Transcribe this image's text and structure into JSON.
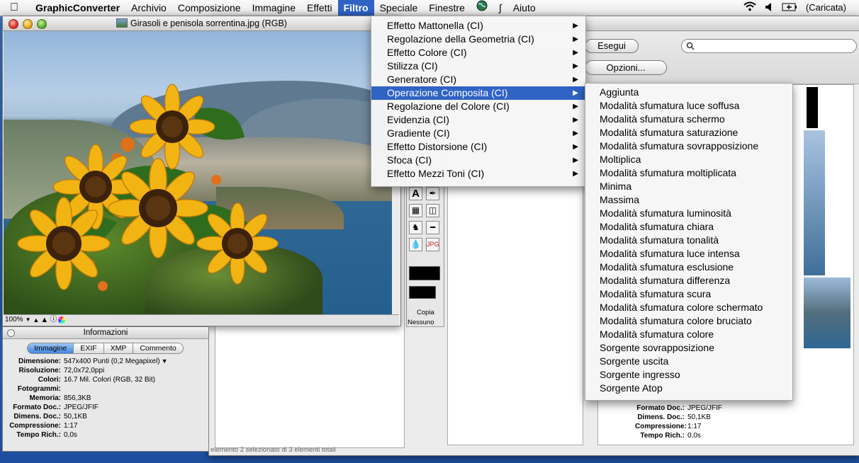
{
  "menubar": {
    "app_name": "GraphicConverter",
    "items": [
      "Archivio",
      "Composizione",
      "Immagine",
      "Effetti",
      "Filtro",
      "Speciale",
      "Finestre"
    ],
    "help": "Aiuto",
    "battery": "(Caricata)"
  },
  "image_window": {
    "title": "Girasoli e penisola sorrentina.jpg (RGB)",
    "zoom": "100%"
  },
  "info_panel": {
    "title": "Informazioni",
    "tabs": [
      "Immagine",
      "EXIF",
      "XMP",
      "Commento"
    ],
    "rows": [
      {
        "k": "Dimensione:",
        "v": "547x400 Punti (0,2 Megapixel)"
      },
      {
        "k": "Risoluzione:",
        "v": "72,0x72,0ppi"
      },
      {
        "k": "Colori:",
        "v": "16.7 Mil. Colori (RGB, 32 Bit)"
      },
      {
        "k": "Fotogrammi:",
        "v": ""
      },
      {
        "k": "Memoria:",
        "v": "856,3KB"
      },
      {
        "k": "Formato Doc.:",
        "v": "JPEG/JFIF"
      },
      {
        "k": "Dimens. Doc.:",
        "v": "50,1KB"
      },
      {
        "k": "Compressione:",
        "v": "1:17"
      },
      {
        "k": "Tempo Rich.:",
        "v": "0,0s"
      }
    ]
  },
  "browser": {
    "run_button": "Esegui",
    "options_button": "Opzioni...",
    "status": "elemento 2 selezionato di 3 elementi totali",
    "tool_labels": {
      "copy": "Copia",
      "none": "Nessuno"
    },
    "preview_info": [
      {
        "k": "Formato Doc.:",
        "v": "JPEG/JFIF"
      },
      {
        "k": "Dimens. Doc.:",
        "v": "50,1KB"
      },
      {
        "k": "Compressione:",
        "v": "1:17"
      },
      {
        "k": "Tempo Rich.:",
        "v": "0,0s"
      }
    ]
  },
  "filter_menu": {
    "items": [
      "Effetto Mattonella (CI)",
      "Regolazione della Geometria (CI)",
      "Effetto Colore (CI)",
      "Stilizza (CI)",
      "Generatore (CI)",
      "Operazione Composita (CI)",
      "Regolazione del Colore (CI)",
      "Evidenzia (CI)",
      "Gradiente (CI)",
      "Effetto Distorsione (CI)",
      "Sfoca (CI)",
      "Effetto Mezzi Toni (CI)"
    ],
    "highlighted_index": 5
  },
  "composite_submenu": {
    "items": [
      "Aggiunta",
      "Modalità sfumatura luce soffusa",
      "Modalità sfumatura schermo",
      "Modalità sfumatura saturazione",
      "Modalità sfumatura sovrapposizione",
      "Moltiplica",
      "Modalità sfumatura moltiplicata",
      "Minima",
      "Massima",
      "Modalità sfumatura luminosità",
      "Modalità sfumatura chiara",
      "Modalità sfumatura tonalità",
      "Modalità sfumatura luce intensa",
      "Modalità sfumatura esclusione",
      "Modalità sfumatura differenza",
      "Modalità sfumatura scura",
      "Modalità sfumatura colore schermato",
      "Modalità sfumatura colore bruciato",
      "Modalità sfumatura colore",
      "Sorgente sovrapposizione",
      "Sorgente uscita",
      "Sorgente ingresso",
      "Sorgente Atop"
    ]
  },
  "colors": {
    "accent": "#2f63c4",
    "desktop": "#2a5fb0"
  }
}
